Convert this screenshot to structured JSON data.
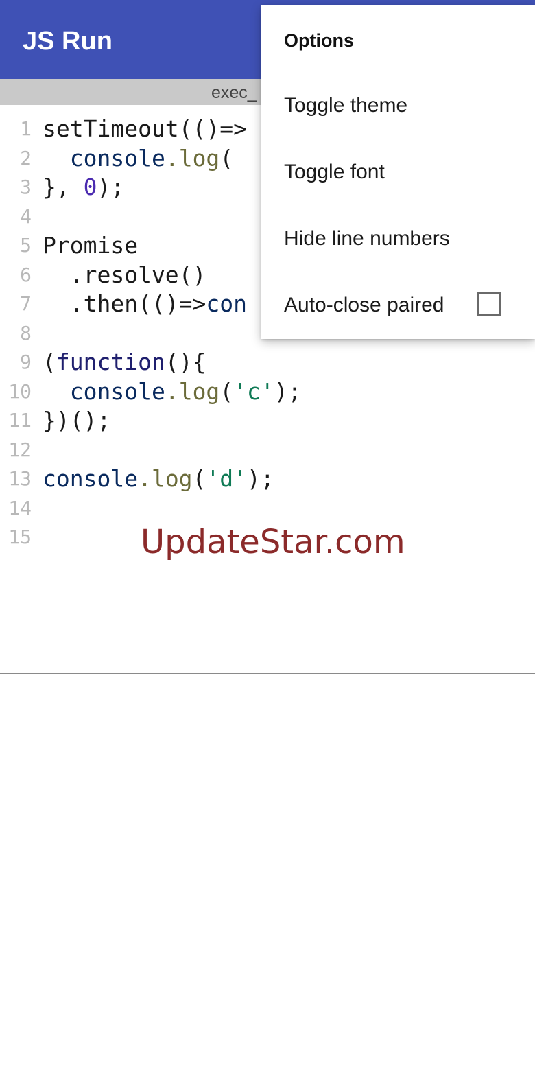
{
  "app_bar": {
    "title": "JS Run",
    "color": "#3f51b5"
  },
  "file_tab": {
    "label": "exec_"
  },
  "editor": {
    "lines": [
      {
        "n": "1",
        "tokens": [
          {
            "t": "setTimeout(()=>",
            "c": "plain"
          }
        ]
      },
      {
        "n": "2",
        "tokens": [
          {
            "t": "  ",
            "c": "plain"
          },
          {
            "t": "console",
            "c": "var"
          },
          {
            "t": ".log",
            "c": "prop"
          },
          {
            "t": "(",
            "c": "plain"
          }
        ]
      },
      {
        "n": "3",
        "tokens": [
          {
            "t": "}, ",
            "c": "plain"
          },
          {
            "t": "0",
            "c": "num"
          },
          {
            "t": ");",
            "c": "plain"
          }
        ]
      },
      {
        "n": "4",
        "tokens": []
      },
      {
        "n": "5",
        "tokens": [
          {
            "t": "Promise",
            "c": "plain"
          }
        ]
      },
      {
        "n": "6",
        "tokens": [
          {
            "t": "  .resolve()",
            "c": "plain"
          }
        ]
      },
      {
        "n": "7",
        "tokens": [
          {
            "t": "  .then(()=>",
            "c": "plain"
          },
          {
            "t": "con",
            "c": "var"
          }
        ]
      },
      {
        "n": "8",
        "tokens": []
      },
      {
        "n": "9",
        "tokens": [
          {
            "t": "(",
            "c": "plain"
          },
          {
            "t": "function",
            "c": "kw"
          },
          {
            "t": "(){",
            "c": "plain"
          }
        ]
      },
      {
        "n": "10",
        "tokens": [
          {
            "t": "  ",
            "c": "plain"
          },
          {
            "t": "console",
            "c": "var"
          },
          {
            "t": ".log",
            "c": "prop"
          },
          {
            "t": "(",
            "c": "plain"
          },
          {
            "t": "'c'",
            "c": "str"
          },
          {
            "t": ");",
            "c": "plain"
          }
        ]
      },
      {
        "n": "11",
        "tokens": [
          {
            "t": "})();",
            "c": "plain"
          }
        ]
      },
      {
        "n": "12",
        "tokens": []
      },
      {
        "n": "13",
        "tokens": [
          {
            "t": "console",
            "c": "var"
          },
          {
            "t": ".log",
            "c": "prop"
          },
          {
            "t": "(",
            "c": "plain"
          },
          {
            "t": "'d'",
            "c": "str"
          },
          {
            "t": ");",
            "c": "plain"
          }
        ]
      },
      {
        "n": "14",
        "tokens": []
      },
      {
        "n": "15",
        "tokens": []
      }
    ]
  },
  "watermark": {
    "text": "UpdateStar.com"
  },
  "options_menu": {
    "header": "Options",
    "items": [
      {
        "label": "Toggle theme"
      },
      {
        "label": "Toggle font"
      },
      {
        "label": "Hide line numbers"
      },
      {
        "label": "Auto-close paired",
        "checkbox": true,
        "checked": false
      }
    ]
  }
}
